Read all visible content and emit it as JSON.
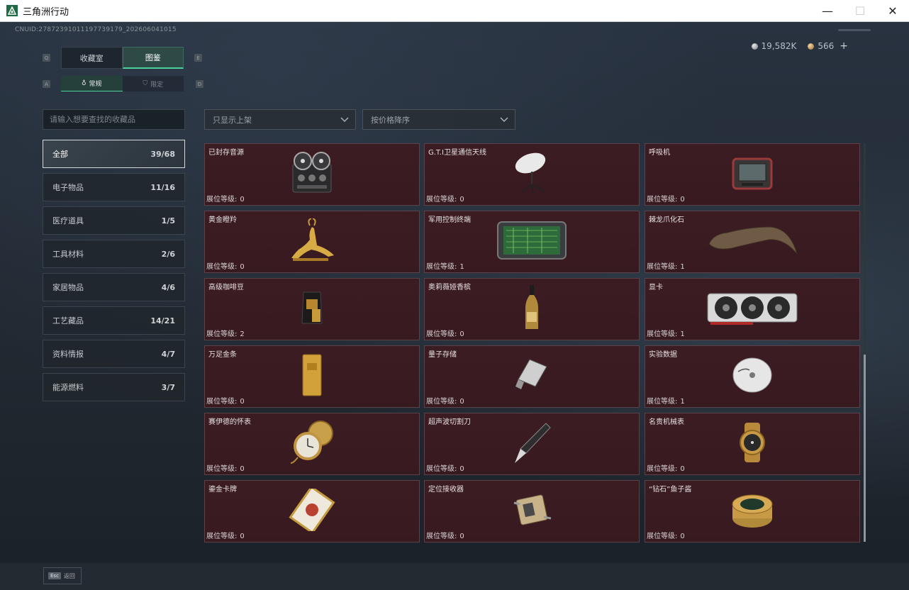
{
  "window": {
    "title": "三角洲行动",
    "minimize": "—",
    "maximize": "☐",
    "close": "✕"
  },
  "uid": "CNUID:2787239101119773917​9_202606041015",
  "currency": {
    "silver": "19,582K",
    "gold": "566",
    "plus": "+"
  },
  "tabs": {
    "left_key": "Q",
    "right_key": "E",
    "main": [
      {
        "label": "收藏室"
      },
      {
        "label": "图鉴"
      }
    ],
    "sub_left_key": "A",
    "sub_right_key": "D",
    "sub": [
      {
        "label": "常规"
      },
      {
        "label": "限定"
      }
    ]
  },
  "search": {
    "placeholder": "请输入想要查找的收藏品"
  },
  "filters": {
    "shelf": "只显示上架",
    "sort": "按价格降序"
  },
  "sidebar": {
    "items": [
      {
        "label": "全部",
        "count": "39/68"
      },
      {
        "label": "电子物品",
        "count": "11/16"
      },
      {
        "label": "医疗道具",
        "count": "1/5"
      },
      {
        "label": "工具材料",
        "count": "2/6"
      },
      {
        "label": "家居物品",
        "count": "4/6"
      },
      {
        "label": "工艺藏品",
        "count": "14/21"
      },
      {
        "label": "资料情报",
        "count": "4/7"
      },
      {
        "label": "能源燃料",
        "count": "3/7"
      }
    ]
  },
  "level_label": "展位等级:",
  "items": [
    {
      "name": "已封存音源",
      "level": "0",
      "icon": "reel-recorder-icon"
    },
    {
      "name": "G.T.I卫星通信天线",
      "level": "0",
      "icon": "satellite-dish-icon"
    },
    {
      "name": "呼吸机",
      "level": "0",
      "icon": "ventilator-icon"
    },
    {
      "name": "黄金瞪羚",
      "level": "0",
      "icon": "gold-gazelle-icon"
    },
    {
      "name": "军用控制终端",
      "level": "1",
      "icon": "control-terminal-icon"
    },
    {
      "name": "棘龙爪化石",
      "level": "1",
      "icon": "claw-fossil-icon"
    },
    {
      "name": "高级咖啡豆",
      "level": "2",
      "icon": "coffee-bag-icon"
    },
    {
      "name": "奥莉薇娅香槟",
      "level": "0",
      "icon": "champagne-icon"
    },
    {
      "name": "显卡",
      "level": "1",
      "icon": "graphics-card-icon"
    },
    {
      "name": "万足金条",
      "level": "0",
      "icon": "gold-bar-icon"
    },
    {
      "name": "量子存储",
      "level": "0",
      "icon": "usb-drive-icon"
    },
    {
      "name": "实验数据",
      "level": "1",
      "icon": "disc-icon"
    },
    {
      "name": "赛伊德的怀表",
      "level": "0",
      "icon": "pocket-watch-icon"
    },
    {
      "name": "超声波切割刀",
      "level": "0",
      "icon": "cutter-icon"
    },
    {
      "name": "名贵机械表",
      "level": "0",
      "icon": "wristwatch-icon"
    },
    {
      "name": "鎏金卡牌",
      "level": "0",
      "icon": "gilded-card-icon"
    },
    {
      "name": "定位接收器",
      "level": "0",
      "icon": "locator-receiver-icon"
    },
    {
      "name": "“钻石”鱼子酱",
      "level": "0",
      "icon": "caviar-tin-icon"
    }
  ],
  "footer": {
    "esc_key": "Esc",
    "back_label": "返回"
  },
  "colors": {
    "accent": "#4bd0a0",
    "card_bg": "#3a1b21",
    "card_border": "#5c4148"
  }
}
